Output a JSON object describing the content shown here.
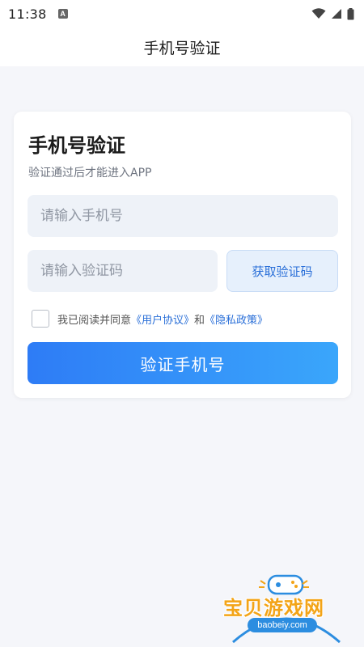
{
  "status_bar": {
    "time": "11:38",
    "notification_glyph": "A",
    "icons": [
      "wifi-icon",
      "signal-icon",
      "battery-icon"
    ]
  },
  "header": {
    "title": "手机号验证"
  },
  "card": {
    "title": "手机号验证",
    "subtitle": "验证通过后才能进入APP",
    "phone_input": {
      "value": "",
      "placeholder": "请输入手机号"
    },
    "code_input": {
      "value": "",
      "placeholder": "请输入验证码"
    },
    "get_code_label": "获取验证码",
    "agreement": {
      "checked": false,
      "prefix": "我已阅读并同意",
      "user_agreement": "《用户协议》",
      "conjunction": "和",
      "privacy_policy": "《隐私政策》"
    },
    "submit_label": "验证手机号"
  },
  "watermark": {
    "brand": "宝贝游戏网",
    "domain": "baobeiy.com"
  },
  "colors": {
    "accent": "#2a6fd8",
    "button_gradient_start": "#2e7cf6",
    "button_gradient_end": "#3aa6fb",
    "input_bg": "#eef2f8",
    "page_bg": "#f5f6fa"
  }
}
